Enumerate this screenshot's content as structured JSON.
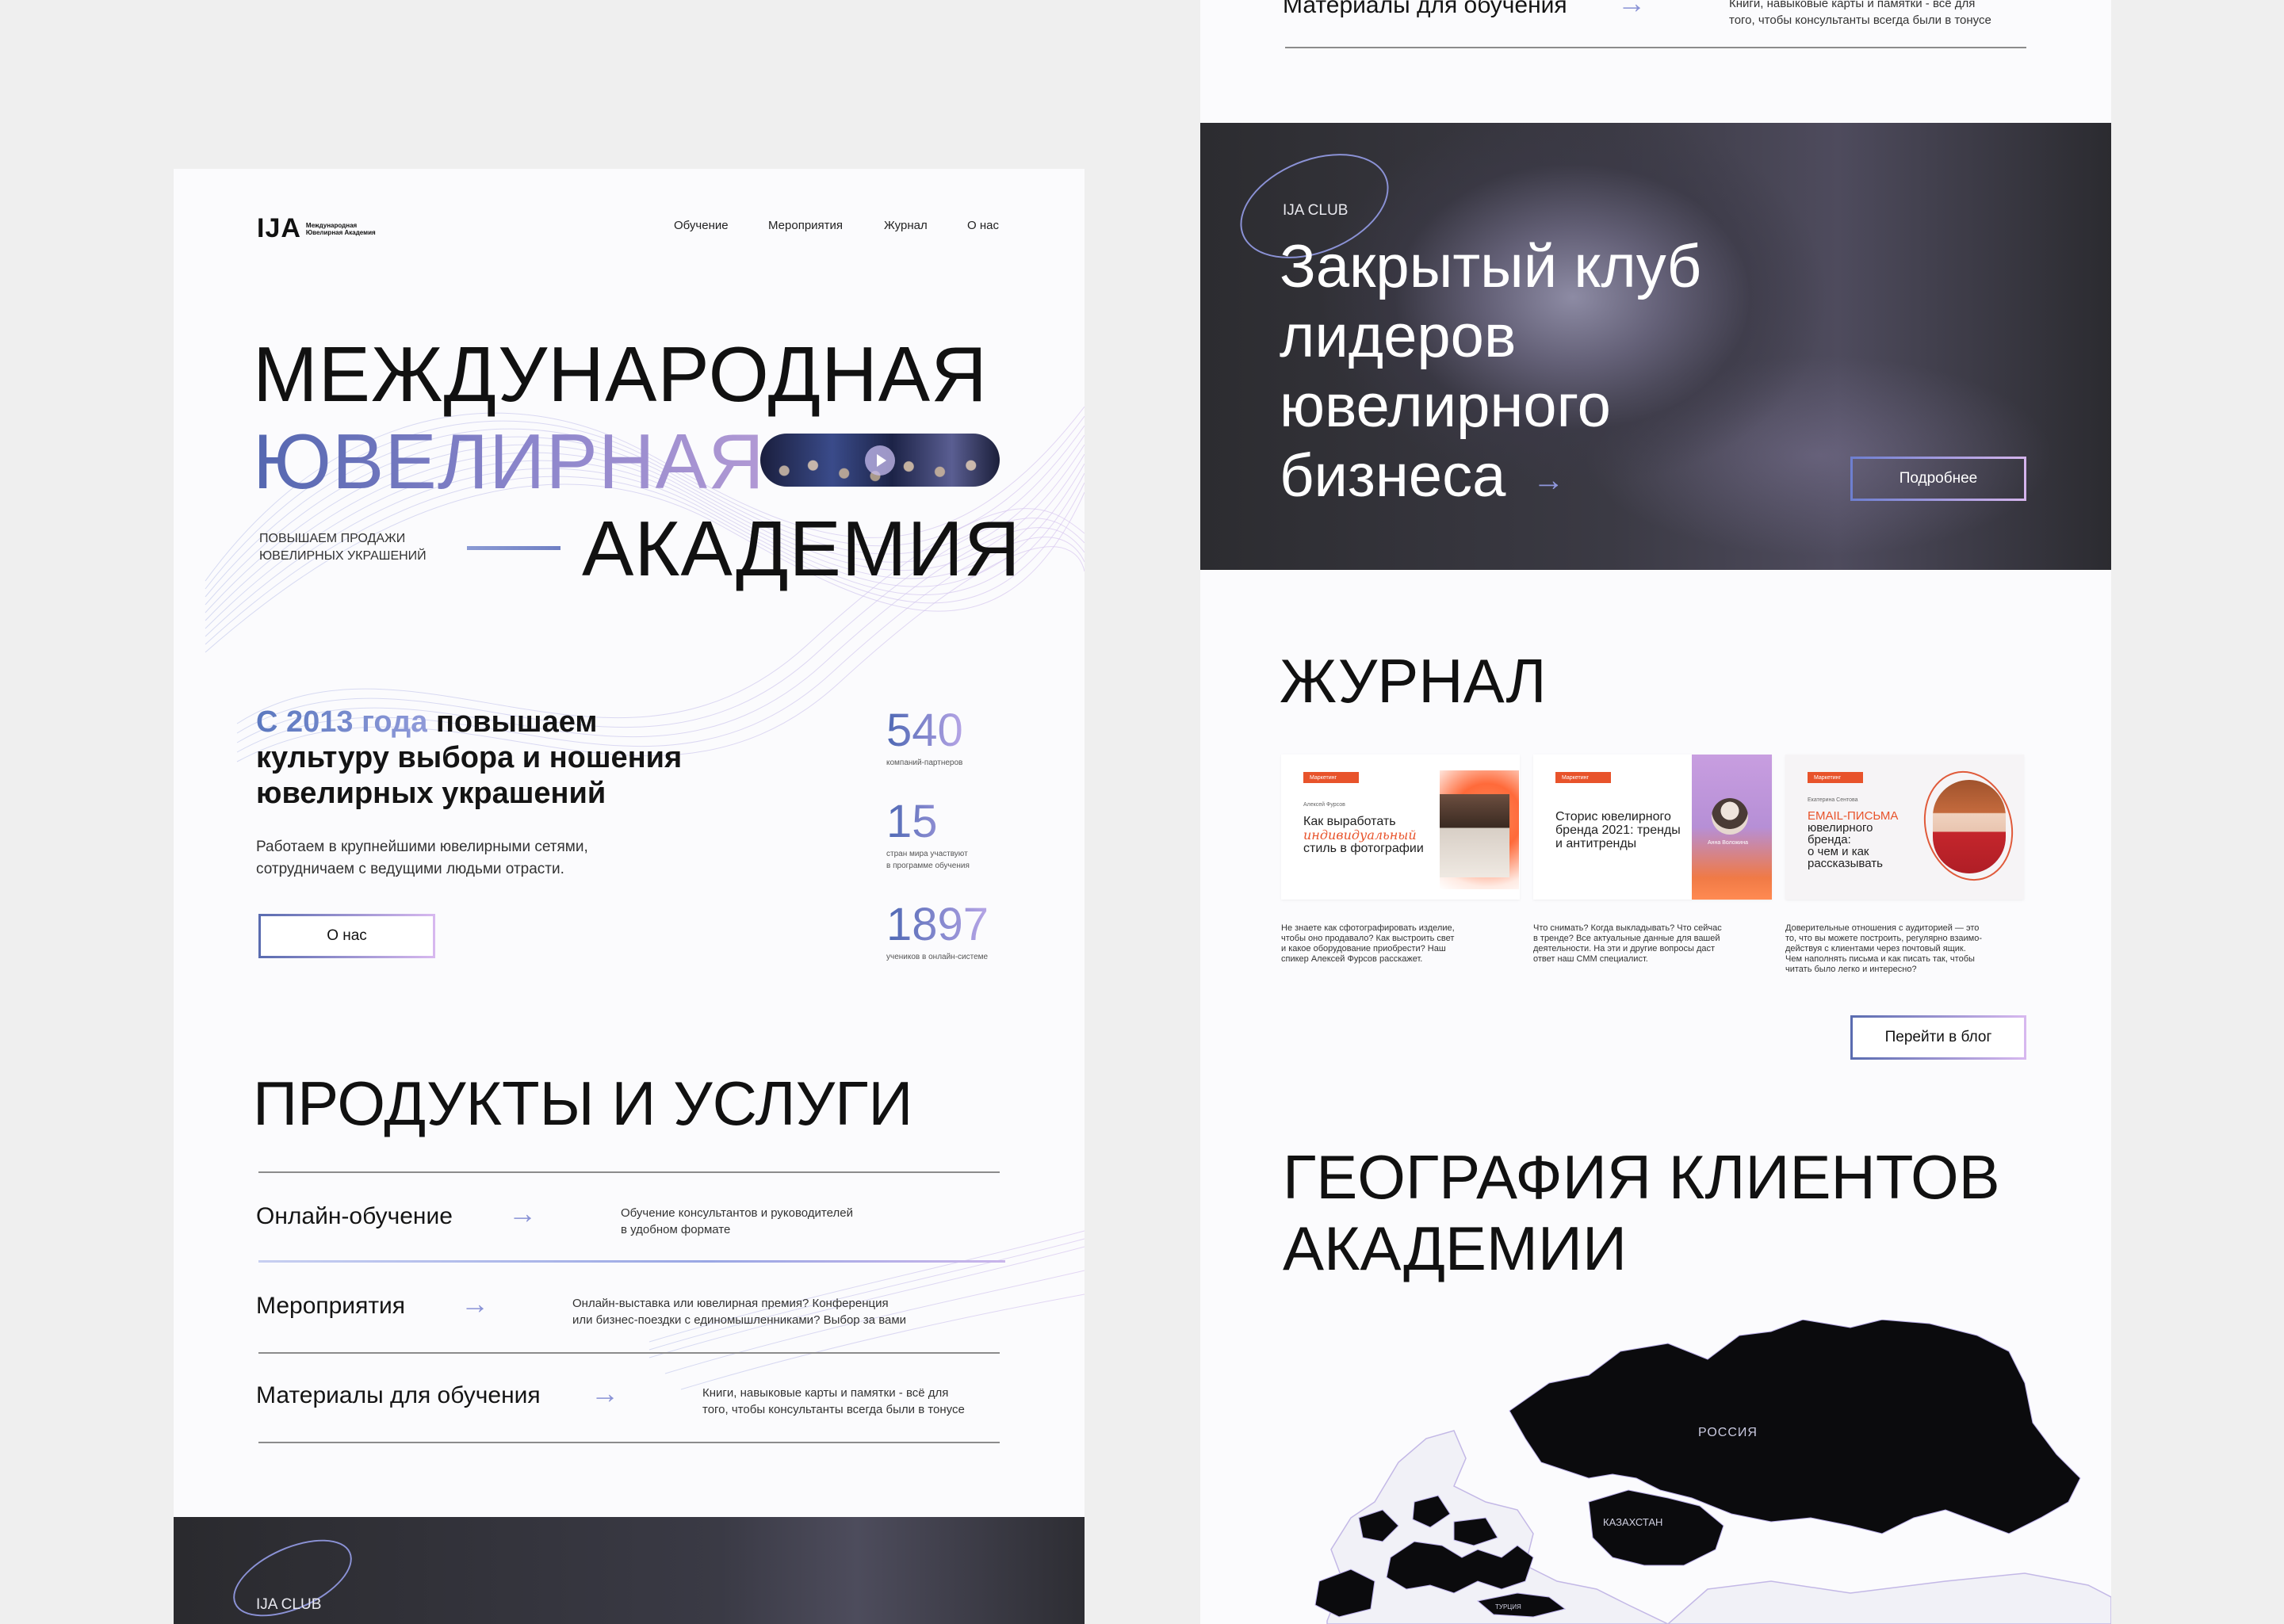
{
  "header": {
    "logo_mark": "IJA",
    "logo_text": "Международная Ювелирная Академия",
    "nav": [
      "Обучение",
      "Мероприятия",
      "Журнал",
      "О нас"
    ]
  },
  "hero": {
    "line1": "МЕЖДУНАРОДНАЯ",
    "line2": "ЮВЕЛИРНАЯ",
    "line3": "АКАДЕМИЯ",
    "tagline_1": "ПОВЫШАЕМ ПРОДАЖИ",
    "tagline_2": "ЮВЕЛИРНЫХ УКРАШЕНИЙ"
  },
  "about": {
    "lead_accent": "С 2013 года",
    "lead_1": " повышаем",
    "lead_2": "культуру выбора и ношения",
    "lead_3": "ювелирных украшений",
    "text_1": "Работаем в крупнейшими ювелирными сетями,",
    "text_2": "сотрудничаем с ведущими людьми отрасти.",
    "button": "О нас",
    "stats": [
      {
        "value": "540",
        "label_1": "компаний-партнеров",
        "label_2": ""
      },
      {
        "value": "15",
        "label_1": "стран мира участвуют",
        "label_2": "в программе обучения"
      },
      {
        "value": "1897",
        "label_1": "учеников в онлайн-системе",
        "label_2": ""
      }
    ]
  },
  "products": {
    "title": "ПРОДУКТЫ И УСЛУГИ",
    "items": [
      {
        "name": "Онлайн-обучение",
        "desc_1": "Обучение консультантов и руководителей",
        "desc_2": "в удобном формате"
      },
      {
        "name": "Мероприятия",
        "desc_1": "Онлайн-выставка или ювелирная премия? Конференция",
        "desc_2": "или бизнес-поездки с единомышленниками? Выбор за вами"
      },
      {
        "name": "Материалы для обучения",
        "desc_1": "Книги, навыковые карты и памятки - всё для",
        "desc_2": "того, чтобы консультанты всегда были в тонусе"
      }
    ]
  },
  "club": {
    "tag": "IJA CLUB",
    "title_1": "Закрытый клуб",
    "title_2": "лидеров",
    "title_3": "ювелирного",
    "title_4": "бизнеса",
    "button": "Подробнее"
  },
  "top_strip": {
    "name": "Материалы для обучения",
    "desc_1": "Книги, навыковые карты и памятки - всё для",
    "desc_2": "того, чтобы консультанты всегда были в тонусе"
  },
  "journal": {
    "title": "ЖУРНАЛ",
    "button": "Перейти в блог",
    "cards": [
      {
        "tag": "Маркетинг",
        "author": "Алексей Фурсов",
        "title_1": "Как выработать",
        "title_2": "индивидуальный",
        "title_3": "стиль в фотографии",
        "desc": [
          "Не знаете как сфотографировать изделие,",
          "чтобы оно продавало? Как выстроить свет",
          "и какое оборудование приобрести? Наш",
          "спикер Алексей Фурсов расскажет."
        ]
      },
      {
        "tag": "Маркетинг",
        "author": "Анна Воложина",
        "title_1": "Сторис ювелирного",
        "title_2": "бренда 2021: тренды",
        "title_3": "и антитренды",
        "desc": [
          "Что снимать? Когда выкладывать? Что сейчас",
          "в тренде? Все актуальные данные для вашей",
          "деятельности. На эти и другие вопросы даст",
          "ответ наш СММ специалист."
        ]
      },
      {
        "tag": "Маркетинг",
        "author": "Екатерина Сентова",
        "title_1": "EMAIL-ПИСЬМА",
        "title_2": "ювелирного",
        "title_3": "бренда:",
        "title_4": "о чем и как",
        "title_5": "рассказывать",
        "desc": [
          "Доверительные отношения с аудиторией — это",
          "то, что вы можете построить, регулярно взаимо-",
          "действуя с клиентами через почтовый ящик.",
          "Чем наполнять письма и как писать так, чтобы",
          "читать было легко и интересно?"
        ]
      }
    ]
  },
  "geography": {
    "title_1": "ГЕОГРАФИЯ КЛИЕНТОВ",
    "title_2": "АКАДЕМИИ",
    "labels": {
      "russia": "РОССИЯ",
      "kazakhstan": "КАЗАХСТАН",
      "turkey": "ТУРЦИЯ"
    }
  },
  "colors": {
    "accent_blue": "#5467b0",
    "accent_violet": "#b199d4",
    "tag_orange": "#e8532b",
    "dark_band": "#2c2c30"
  }
}
